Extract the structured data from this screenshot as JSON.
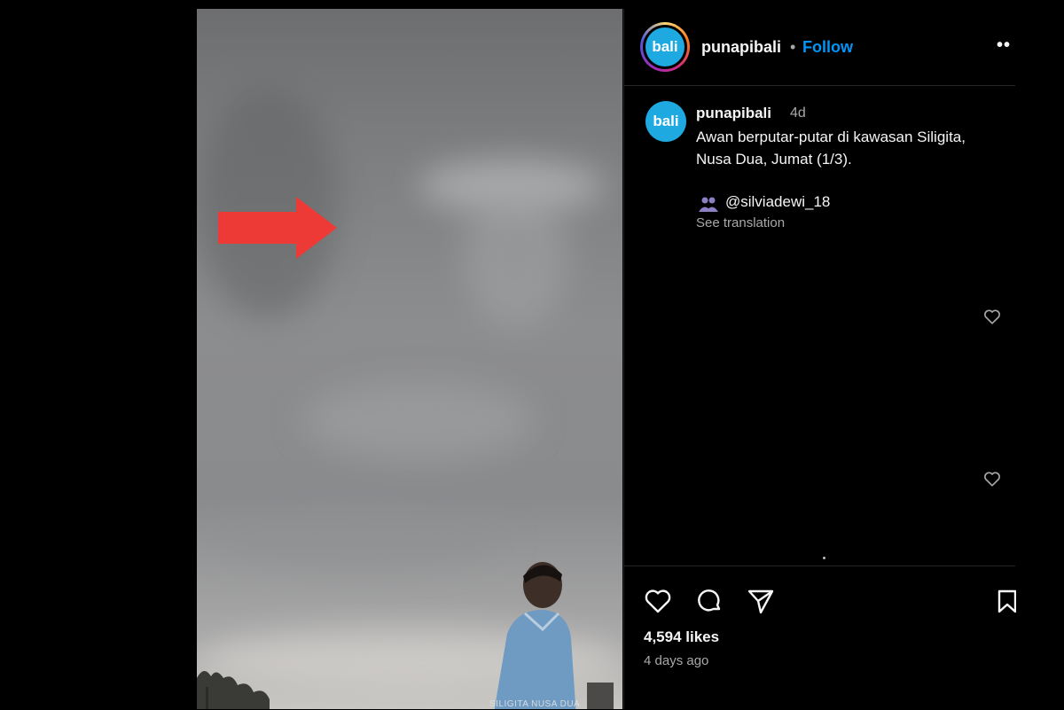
{
  "post": {
    "media": {
      "watermark": "SILIGITA NUSA DUA"
    },
    "header": {
      "avatar_text": "bali",
      "username": "punapibali",
      "separator": "•",
      "follow_label": "Follow",
      "more_label": "••"
    },
    "caption": {
      "avatar_text": "bali",
      "username": "punapibali",
      "time_ago": "4d",
      "text": "Awan berputar-putar di kawasan Siligita, Nusa Dua, Jumat (1/3).",
      "tagged_user": "@silviadewi_18",
      "see_translation": "See translation"
    },
    "stats": {
      "likes": "4,594 likes",
      "posted": "4 days ago"
    },
    "colors": {
      "accent": "#0095f6",
      "avatar_bg": "#1ea9e1",
      "arrow": "#ee3a36"
    },
    "icons": [
      "heart-icon",
      "comment-icon",
      "share-icon",
      "bookmark-icon",
      "more-icon"
    ]
  }
}
